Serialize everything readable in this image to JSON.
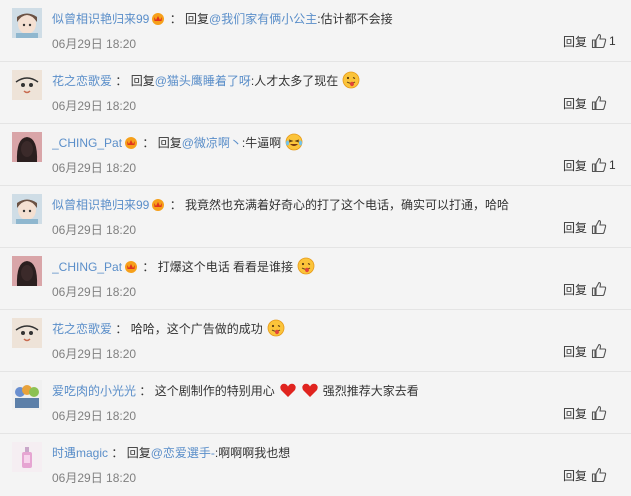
{
  "comments": [
    {
      "user": "似曾相识艳归来99",
      "prefix": "回复",
      "mention": "@我们家有俩小公主",
      "text": ":估计都不会接",
      "time": "06月29日 18:20",
      "reply": "回复",
      "likes": "1",
      "avatar": "anime-girl-avatar"
    },
    {
      "user": "花之恋歌爱",
      "prefix": "回复",
      "mention": "@猫头鹰睡着了呀",
      "text": ":人才太多了现在",
      "time": "06月29日 18:20",
      "reply": "回复",
      "likes": "",
      "avatar": "cartoon-face-avatar",
      "emoji": "tongue-out-emoji"
    },
    {
      "user": "_CHING_Pat",
      "prefix": "回复",
      "mention": "@微凉啊丶",
      "text": ":牛逼啊",
      "time": "06月29日 18:20",
      "reply": "回复",
      "likes": "1",
      "avatar": "dark-hair-avatar",
      "emoji": "laughing-tears-emoji"
    },
    {
      "user": "似曾相识艳归来99",
      "prefix": "",
      "mention": "",
      "text": "我竟然也充满着好奇心的打了这个电话，确实可以打通，哈哈",
      "time": "06月29日 18:20",
      "reply": "回复",
      "likes": "",
      "avatar": "anime-girl-avatar"
    },
    {
      "user": "_CHING_Pat",
      "prefix": "",
      "mention": "",
      "text": "打爆这个电话 看看是谁接",
      "time": "06月29日 18:20",
      "reply": "回复",
      "likes": "",
      "avatar": "dark-hair-avatar",
      "emoji": "tongue-out-emoji"
    },
    {
      "user": "花之恋歌爱",
      "prefix": "",
      "mention": "",
      "text": "哈哈，这个广告做的成功",
      "time": "06月29日 18:20",
      "reply": "回复",
      "likes": "",
      "avatar": "cartoon-face-avatar",
      "emoji": "tongue-out-emoji"
    },
    {
      "user": "爱吃肉的小光光",
      "prefix": "",
      "mention": "",
      "text": "这个剧制作的特别用心",
      "text2": "强烈推荐大家去看",
      "time": "06月29日 18:20",
      "reply": "回复",
      "likes": "",
      "avatar": "group-avatar"
    },
    {
      "user": "时遇magic",
      "prefix": "回复",
      "mention": "@恋爱選手-",
      "text": ":啊啊啊我也想",
      "time": "06月29日 18:20",
      "reply": "回复",
      "likes": "",
      "avatar": "perfume-bottle-avatar"
    }
  ],
  "colors": {
    "username": "#5a8ec9",
    "mention": "#5a8ec9",
    "meta": "#808080",
    "background": "#f4f4f4"
  }
}
